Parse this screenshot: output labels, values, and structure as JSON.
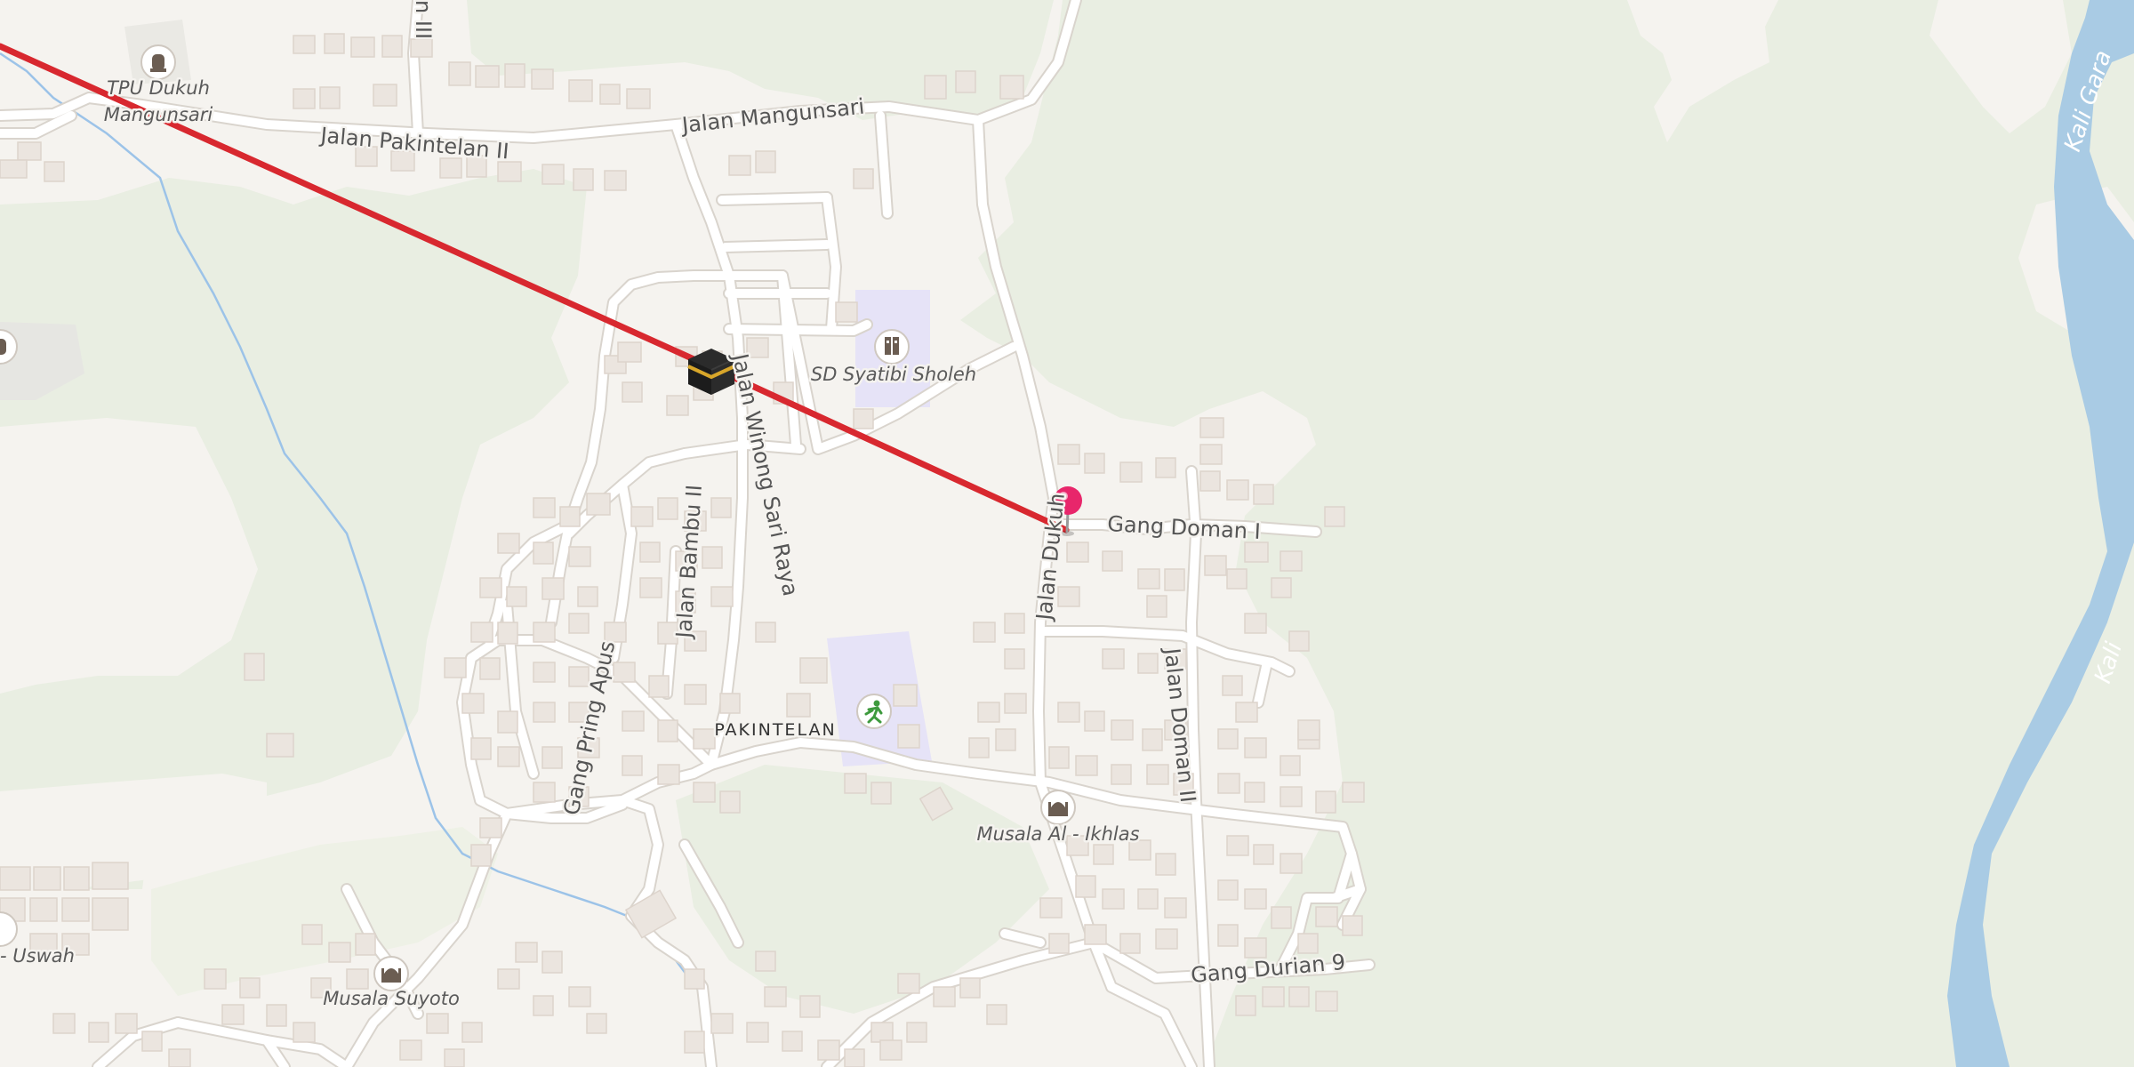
{
  "colors": {
    "land": "#f5f3ef",
    "vegetation": "#e9eee2",
    "green_area": "#eef1e6",
    "water": "#a9cbe4",
    "stream": "#9cc3e8",
    "road": "#ffffff",
    "road_casing": "#d9d4cd",
    "building": "#ebe5df",
    "school_area": "#e6e3f7",
    "route_line": "#d8282f",
    "pin": "#e8266b"
  },
  "roads": {
    "jalan_mangunsari": "Jalan Mangunsari",
    "jalan_pakintelan_ii": "Jalan Pakintelan II",
    "jalan_iii_partial": "n III",
    "jalan_winong_sari_raya": "Jalan Winong Sari Raya",
    "jalan_bambu_ii": "Jalan Bambu II",
    "gang_pring_apus": "Gang Pring Apus",
    "jalan_dukuh": "Jalan Dukuh",
    "gang_doman_i": "Gang Doman I",
    "jalan_doman_ii": "Jalan Doman II",
    "gang_durian_9": "Gang Durian 9"
  },
  "pois": {
    "tpu_dukuh_line1": "TPU Dukuh",
    "tpu_dukuh_line2": "Mangunsari",
    "sd_syatibi_sholeh": "SD Syatibi Sholeh",
    "musala_al_ikhlas": "Musala Al - Ikhlas",
    "musala_suyoto": "Musala Suyoto",
    "uswah_partial": "- Uswah"
  },
  "places": {
    "pakintelan": "PAKINTELAN"
  },
  "water": {
    "kali_garang_partial_1": "Kali Gara",
    "kali_garang_partial_2": "Kali"
  },
  "icons": {
    "kaaba": "kaaba-icon",
    "cemetery": "cemetery-icon",
    "school": "school-icon",
    "sports": "sports-icon",
    "mosque": "mosque-icon",
    "location_pin": "location-pin-icon"
  }
}
